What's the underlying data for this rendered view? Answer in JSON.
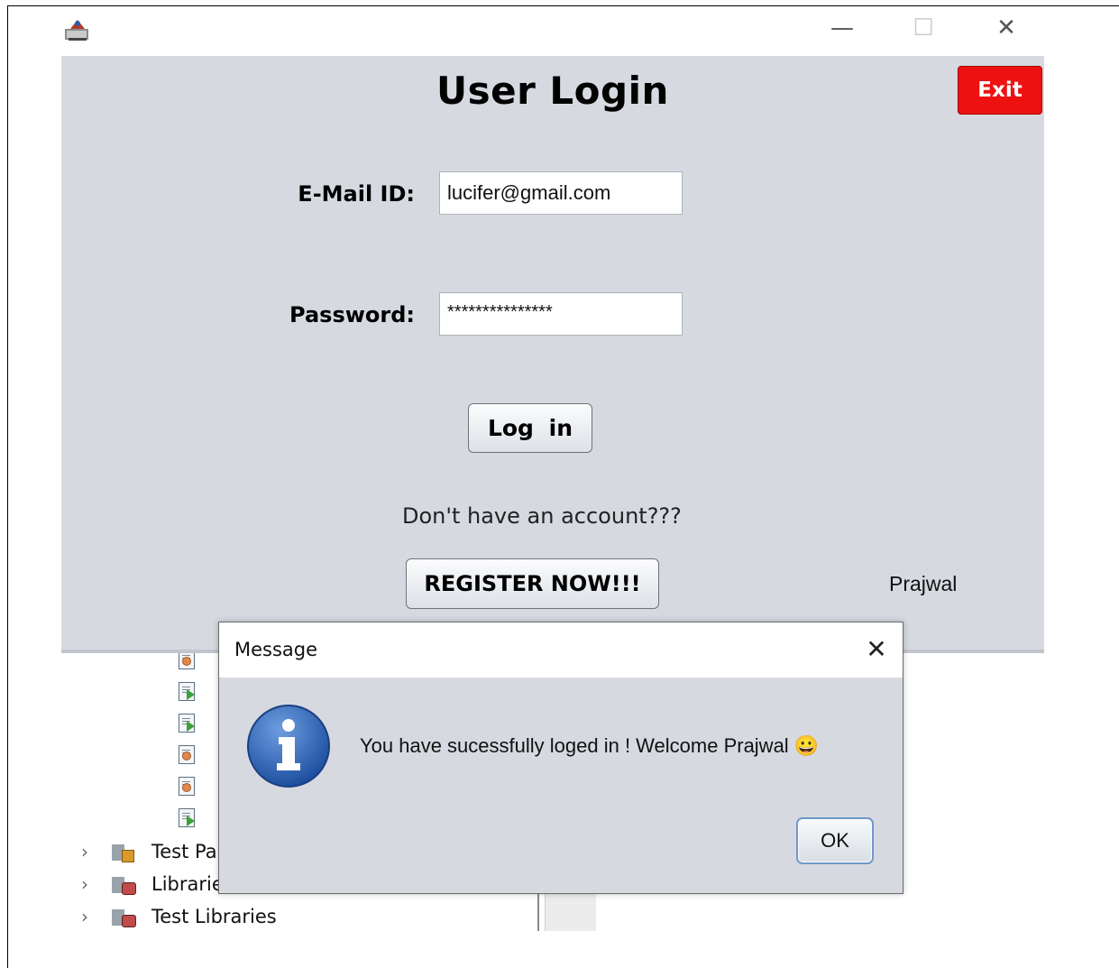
{
  "ide_tree": {
    "rows": [
      {
        "label": "Test Pa",
        "icon": "test-packages-folder-icon"
      },
      {
        "label": "Librarie",
        "icon": "libraries-folder-icon"
      },
      {
        "label": "Test Libraries",
        "icon": "test-libraries-folder-icon"
      }
    ],
    "chevron": "›"
  },
  "window": {
    "icon": "java-app-icon",
    "minimize": "—",
    "maximize": "☐",
    "close": "✕"
  },
  "login": {
    "title": "User Login",
    "exit_label": "Exit",
    "email_label": "E-Mail ID:",
    "email_value": "lucifer@gmail.com",
    "password_label": "Password:",
    "password_value": "***************",
    "login_label": "Log in",
    "no_account_text": "Don't have an account???",
    "register_label": "REGISTER NOW!!!",
    "credit": "Prajwal"
  },
  "colors": {
    "exit_bg": "#ee1111",
    "window_bg": "#d6d9e0",
    "info_icon_blue": "#2a62b5"
  },
  "dialog": {
    "title": "Message",
    "close": "✕",
    "icon": "info-icon",
    "message": "You have sucessfully loged in ! Welcome Prajwal 😀",
    "ok_label": "OK"
  }
}
